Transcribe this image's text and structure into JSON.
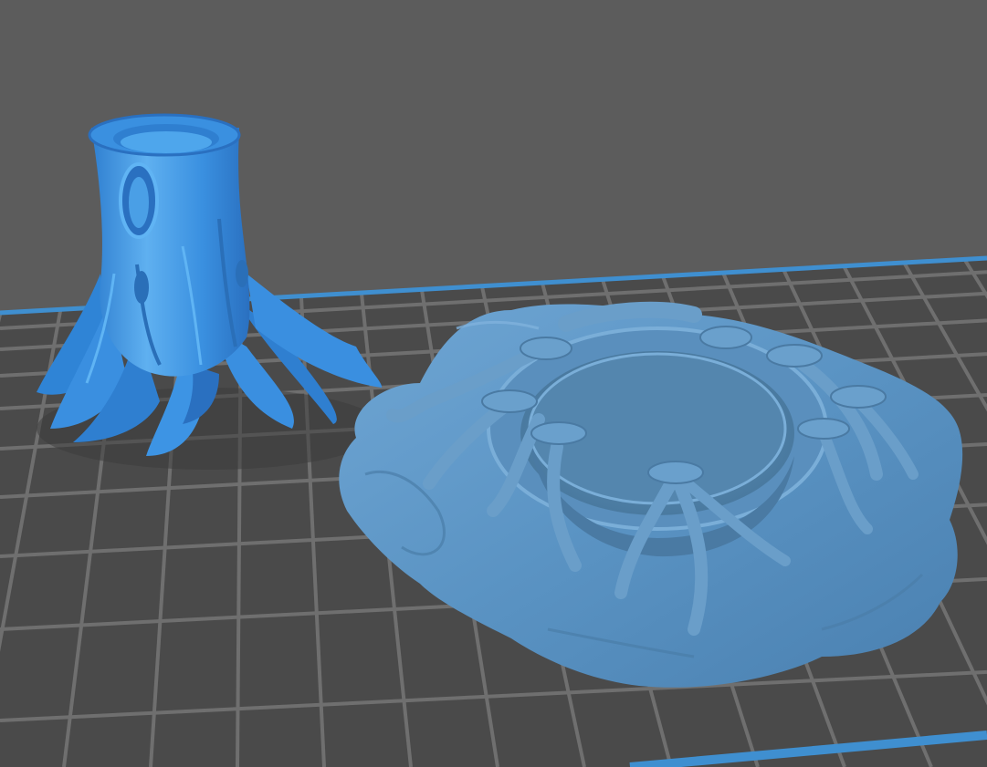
{
  "viewport": {
    "background_color": "#5c5c5c",
    "plate_color": "#4a4a4a",
    "grid_line_color": "#6f6f6f",
    "plate_edge_color": "#3f8fd0"
  },
  "models": [
    {
      "id": "tree-stump",
      "color": "#3f95e0",
      "state": "selected"
    },
    {
      "id": "root-base",
      "color": "#5e9ac9",
      "state": "unselected"
    }
  ]
}
